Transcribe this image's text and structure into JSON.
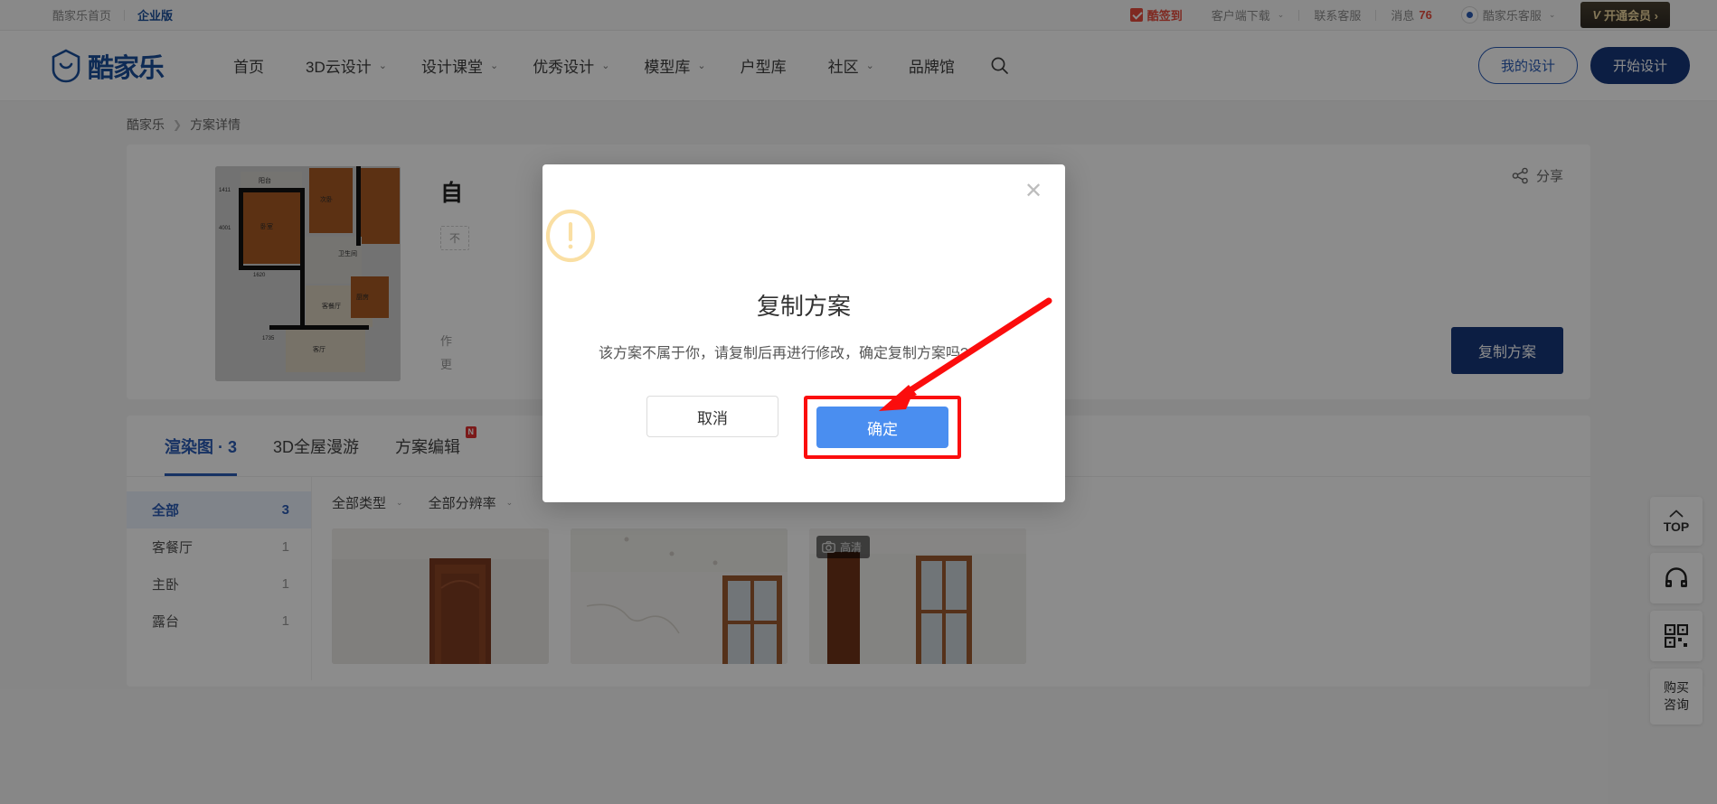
{
  "topbar": {
    "home_label": "酷家乐首页",
    "enterprise_label": "企业版",
    "signin_label": "酷签到",
    "client_download_label": "客户端下载",
    "contact_label": "联系客服",
    "message_label": "消息",
    "message_count": "76",
    "service_label": "酷家乐客服",
    "vip_label": "开通会员 ›",
    "vip_mark": "V"
  },
  "nav": {
    "logo_text": "酷家乐",
    "items": [
      {
        "label": "首页",
        "caret": ""
      },
      {
        "label": "3D云设计",
        "caret": "⌄"
      },
      {
        "label": "设计课堂",
        "caret": "⌄"
      },
      {
        "label": "优秀设计",
        "caret": "⌄"
      },
      {
        "label": "模型库",
        "caret": "⌄"
      },
      {
        "label": "户型库",
        "caret": ""
      },
      {
        "label": "社区",
        "caret": "⌄"
      },
      {
        "label": "品牌馆",
        "caret": ""
      }
    ],
    "my_design_label": "我的设计",
    "start_design_label": "开始设计"
  },
  "breadcrumb": {
    "root": "酷家乐",
    "separator": "❯",
    "current": "方案详情"
  },
  "detail": {
    "title": "自",
    "tag": "不",
    "meta_line1": "作",
    "meta_line2": "更",
    "share_label": "分享",
    "copy_label": "复制方案",
    "floorplan_labels": [
      "阳台",
      "卧室",
      "次卧",
      "餐厅",
      "客餐厅",
      "卫生间",
      "厨房",
      "客厅"
    ],
    "floorplan_dims": [
      "1411",
      "4001",
      "1620",
      "1735"
    ]
  },
  "tabs": {
    "items": [
      {
        "label": "渲染图 · 3",
        "active": true,
        "badge": ""
      },
      {
        "label": "3D全屋漫游",
        "active": false,
        "badge": ""
      },
      {
        "label": "方案编辑",
        "active": false,
        "badge": "N"
      }
    ]
  },
  "sidelist": {
    "rows": [
      {
        "label": "全部",
        "count": "3",
        "active": true
      },
      {
        "label": "客餐厅",
        "count": "1",
        "active": false
      },
      {
        "label": "主卧",
        "count": "1",
        "active": false
      },
      {
        "label": "露台",
        "count": "1",
        "active": false
      }
    ]
  },
  "filters": [
    {
      "label": "全部类型",
      "caret": "⌄"
    },
    {
      "label": "全部分辨率",
      "caret": "⌄"
    }
  ],
  "thumbs": [
    {
      "hd_badge": ""
    },
    {
      "hd_badge": ""
    },
    {
      "hd_badge": "高清"
    }
  ],
  "rail": {
    "top_label": "TOP",
    "headset_name": "headset-icon",
    "qr_name": "qrcode-icon",
    "consult_line1": "购买",
    "consult_line2": "咨询"
  },
  "modal": {
    "title": "复制方案",
    "body": "该方案不属于你，请复制后再进行修改，确定复制方案吗?",
    "cancel_label": "取消",
    "confirm_label": "确定",
    "close_label": "✕"
  },
  "colors": {
    "brand_blue": "#17387a",
    "link_blue": "#2a5bb5",
    "primary_button": "#4a8ef0",
    "warn_yellow": "#fadfa3",
    "annotation_red": "#fb0d0d",
    "alert_red": "#e74c3c"
  }
}
